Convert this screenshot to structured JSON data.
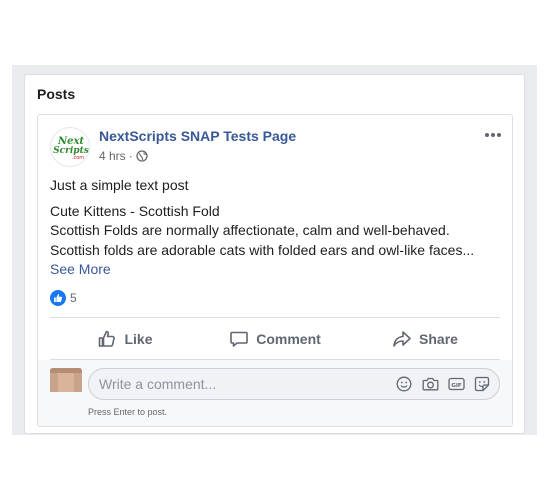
{
  "section": {
    "title": "Posts"
  },
  "post": {
    "page_name": "NextScripts SNAP Tests Page",
    "time": "4 hrs",
    "privacy_separator": "·",
    "avatar_text_top": "Next",
    "avatar_text_bottom": "Scripts",
    "avatar_text_suffix": ".com",
    "lines": [
      "Just a simple text post",
      "Cute Kittens - Scottish Fold",
      "Scottish Folds are normally affectionate, calm and well-behaved.",
      "Scottish folds are adorable cats with folded ears and owl-like faces..."
    ],
    "see_more": "See More",
    "reaction_count": "5",
    "actions": {
      "like": "Like",
      "comment": "Comment",
      "share": "Share"
    },
    "comment": {
      "placeholder": "Write a comment...",
      "hint": "Press Enter to post."
    }
  },
  "colors": {
    "brand_link": "#385898",
    "like_blue": "#1877f2",
    "logo_green": "#2e8b2e",
    "logo_red": "#d0271d"
  },
  "icons": [
    "globe-icon",
    "more-options-icon",
    "like-icon",
    "comment-icon",
    "share-icon",
    "emoji-icon",
    "camera-icon",
    "gif-icon",
    "sticker-icon"
  ]
}
